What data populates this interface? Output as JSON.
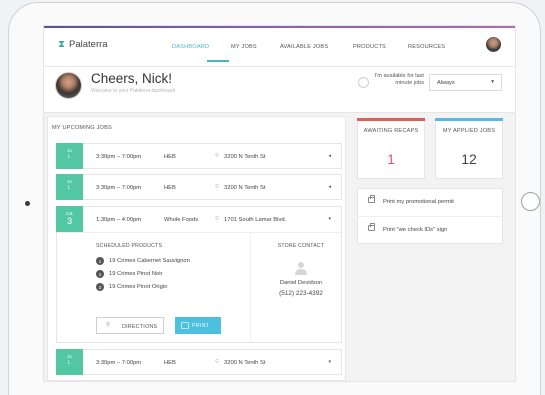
{
  "app": {
    "name": "Palaterra"
  },
  "nav": {
    "items": [
      {
        "label": "DASHBOARD",
        "active": true
      },
      {
        "label": "MY JOBS",
        "active": false
      },
      {
        "label": "AVAILABLE JOBS",
        "active": false
      },
      {
        "label": "PRODUCTS",
        "active": false
      },
      {
        "label": "RESOURCES",
        "active": false
      }
    ]
  },
  "welcome": {
    "greeting": "Cheers, Nick!",
    "subtitle": "Welcome to your Palaterra dashboard",
    "availability_label": "I'm available for last minute jobs",
    "availability_value": "Always"
  },
  "jobs": {
    "title": "MY UPCOMING JOBS",
    "rows": [
      {
        "month": "JU",
        "day": "L",
        "time": "3:30pm – 7:00pm",
        "store": "HEB",
        "address": "3200 N Tenth St"
      },
      {
        "month": "JU",
        "day": "L",
        "time": "3:30pm – 7:00pm",
        "store": "HEB",
        "address": "3200 N Tenth St"
      },
      {
        "month": "JUL",
        "day": "3",
        "time": "1:30pm – 4:00pm",
        "store": "Whole Foods",
        "address": "1701 South Lamar Blvd."
      },
      {
        "month": "JU",
        "day": "L",
        "time": "3:30pm – 7:00pm",
        "store": "HEB",
        "address": "3200 N Tenth St"
      }
    ],
    "expanded": {
      "scheduled_title": "SCHEDULED PRODUCTS",
      "products": [
        {
          "num": "1",
          "name": "19 Crimes Cabernet Sauvignon"
        },
        {
          "num": "2",
          "name": "19 Crimes Pinot Noir"
        },
        {
          "num": "3",
          "name": "19 Crimes Pinot Origio"
        }
      ],
      "contact_title": "STORE CONTACT",
      "contact_name": "Daniel Devidson",
      "contact_phone": "(512) 223-4392",
      "directions_label": "DIRECTIONS",
      "print_label": "PRINT"
    }
  },
  "stats": {
    "awaiting": {
      "label": "AWAITING RECAPS",
      "value": "1",
      "color": "#e25b5b"
    },
    "applied": {
      "label": "MY APPLIED JOBS",
      "value": "12",
      "color": "#5bb7e5"
    }
  },
  "links": [
    {
      "label": "Print my promotional permit"
    },
    {
      "label": "Print \"we check IDs\" sign"
    }
  ],
  "icons": {
    "caret": "▾",
    "pin": "⚲",
    "alarm": "alarm-clock-icon"
  }
}
